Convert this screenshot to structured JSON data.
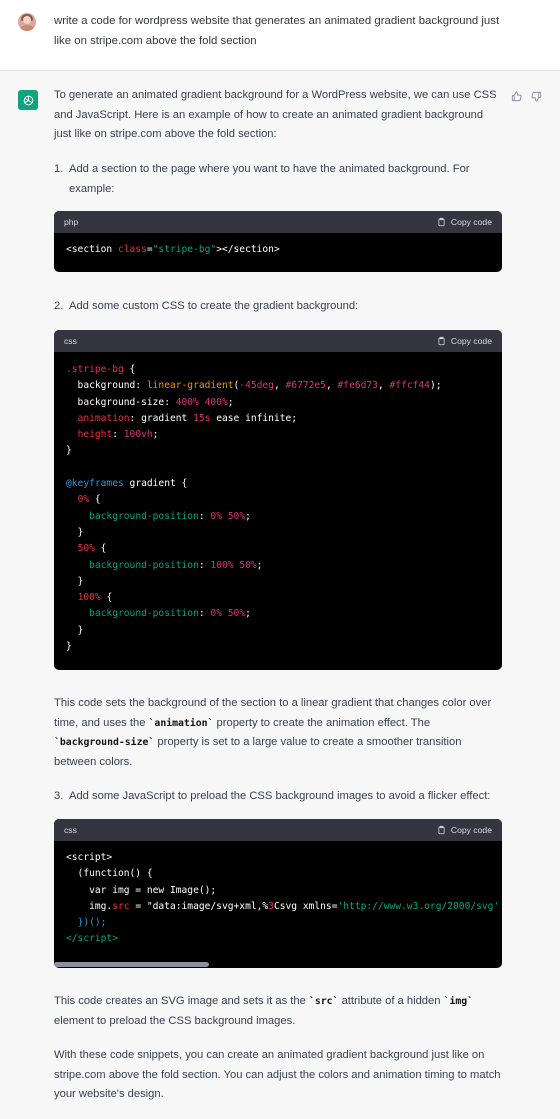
{
  "user": {
    "message": "write a code for wordpress website that generates an animated gradient background just like on stripe.com above the fold section"
  },
  "assistant": {
    "intro": "To generate an animated gradient background for a WordPress website, we can use CSS and JavaScript. Here is an example of how to create an animated gradient background just like on stripe.com above the fold section:",
    "steps": [
      {
        "num": "1.",
        "text": "Add a section to the page where you want to have the animated background. For example:"
      },
      {
        "num": "2.",
        "text": "Add some custom CSS to create the gradient background:"
      },
      {
        "num": "3.",
        "text": "Add some JavaScript to preload the CSS background images to avoid a flicker effect:"
      }
    ],
    "code_blocks": [
      {
        "lang": "php",
        "copy_label": "Copy code"
      },
      {
        "lang": "css",
        "copy_label": "Copy code"
      },
      {
        "lang": "css",
        "copy_label": "Copy code"
      }
    ],
    "para1": {
      "a": "This code sets the background of the section to a linear gradient that changes color over time, and uses the ",
      "code1": "`animation`",
      "b": " property to create the animation effect. The ",
      "code2": "`background-size`",
      "c": " property is set to a large value to create a smoother transition between colors."
    },
    "para2": {
      "a": "This code creates an SVG image and sets it as the ",
      "code1": "`src`",
      "b": " attribute of a hidden ",
      "code2": "`img`",
      "c": " element to preload the CSS background images."
    },
    "para3": "With these code snippets, you can create an animated gradient background just like on stripe.com above the fold section. You can adjust the colors and animation timing to match your website's design."
  },
  "colors": {
    "accent": "#10a37f",
    "code_header": "#343541",
    "code_bg": "#000000"
  },
  "icons": [
    "chatgpt-logo-icon",
    "thumbs-up-icon",
    "thumbs-down-icon",
    "clipboard-icon"
  ]
}
